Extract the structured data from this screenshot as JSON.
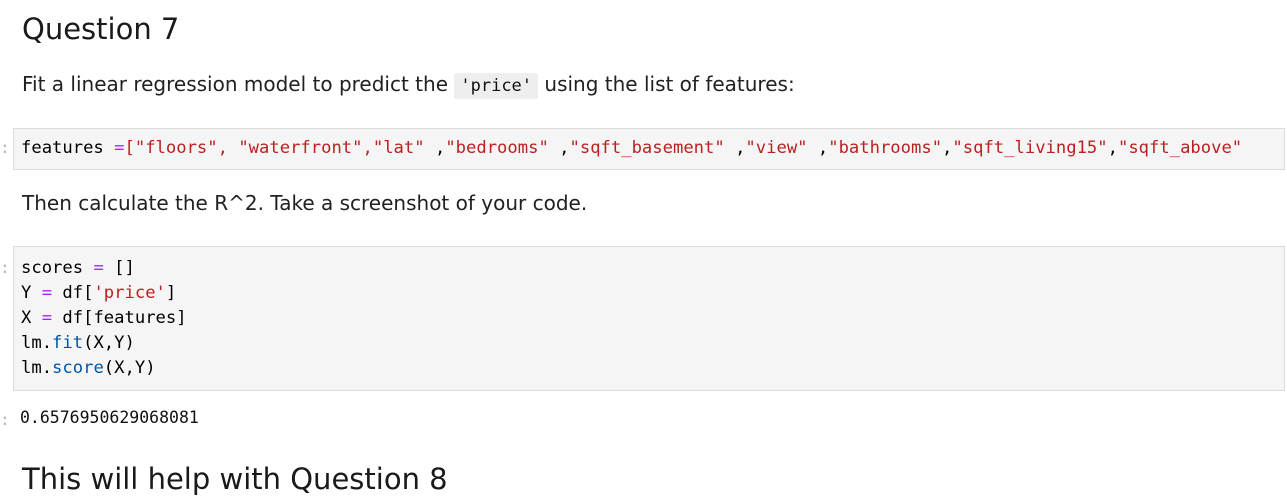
{
  "heading": "Question 7",
  "intro": {
    "before": "Fit a linear regression model to predict the ",
    "code": "'price'",
    "after": " using the list of features:"
  },
  "features_cell": {
    "name": "features",
    "op": " =",
    "items": [
      "[\"floors\",",
      " \"waterfront\",",
      "\"lat\"",
      " ,",
      "\"bedrooms\"",
      " ,",
      "\"sqft_basement\"",
      " ,",
      "\"view\"",
      " ,",
      "\"bathrooms\"",
      ",",
      "\"sqft_living15\"",
      ",",
      "\"sqft_above\""
    ]
  },
  "instruction": "Then calculate the R^2. Take a screenshot of your code.",
  "code_cell": {
    "l1": {
      "var": "scores",
      "op": " = ",
      "rest": "[]"
    },
    "l2": {
      "var": "Y",
      "op": " = ",
      "pre": "df[",
      "str": "'price'",
      "post": "]"
    },
    "l3": {
      "var": "X",
      "op": " = ",
      "rest": "df[features]"
    },
    "l4": {
      "obj": "lm.",
      "fn": "fit",
      "args": "(X,Y)"
    },
    "l5": {
      "obj": "lm.",
      "fn": "score",
      "args": "(X,Y)"
    }
  },
  "output": "0.6576950629068081",
  "next_heading": "This will help with Question 8"
}
